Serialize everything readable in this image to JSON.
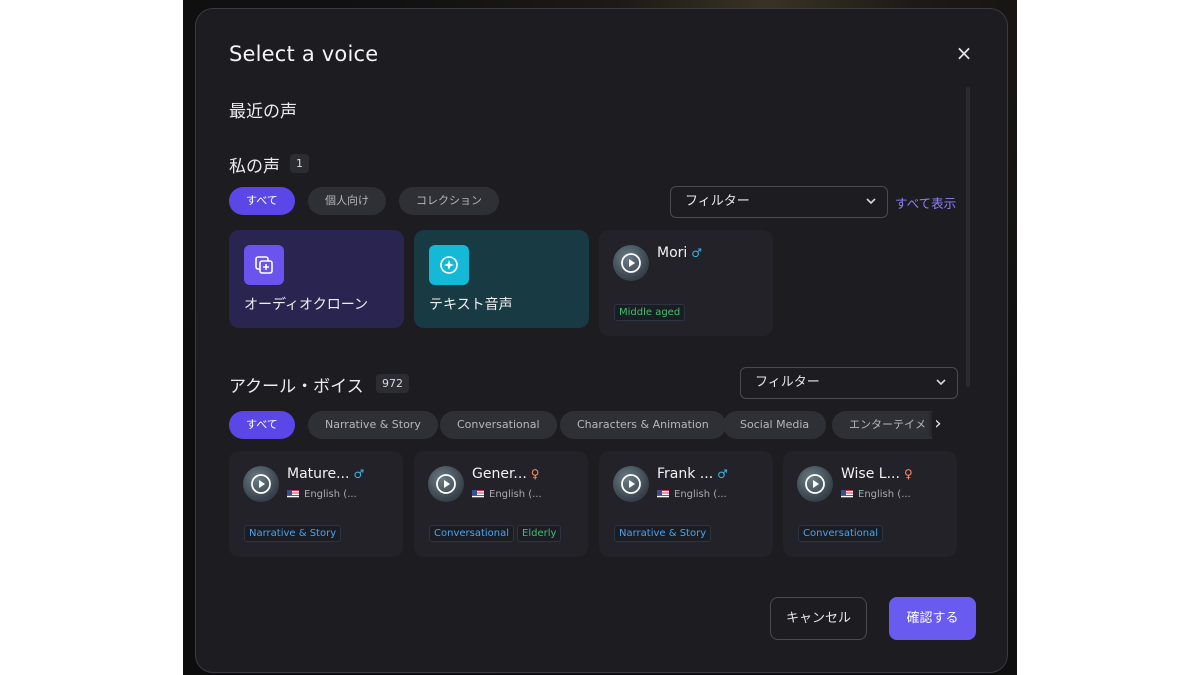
{
  "modal": {
    "title": "Select a voice",
    "close_symbol": "×"
  },
  "recent": {
    "heading": "最近の声"
  },
  "my_voices": {
    "heading": "私の声",
    "count": "1",
    "tabs": [
      "すべて",
      "個人向け",
      "コレクション"
    ],
    "filter_label": "フィルター",
    "show_all": "すべて表示",
    "create_cards": [
      {
        "label": "オーディオクローン",
        "icon": "audio-clone-icon",
        "bg": "#2a2550",
        "icon_bg": "#6b54ee"
      },
      {
        "label": "テキスト音声",
        "icon": "text-to-speech-icon",
        "bg": "#173a43",
        "icon_bg": "#16b8d8"
      }
    ],
    "voices": [
      {
        "name": "Mori",
        "gender": "♂",
        "gender_type": "male",
        "tags": [
          {
            "text": "Middle aged",
            "color": "green"
          }
        ]
      }
    ]
  },
  "acool_voices": {
    "heading": "アクール・ボイス",
    "count": "972",
    "filter_label": "フィルター",
    "categories": [
      "すべて",
      "Narrative & Story",
      "Conversational",
      "Characters & Animation",
      "Social Media",
      "エンターテイメ"
    ],
    "next_symbol": "›",
    "voices": [
      {
        "name": "Mature...",
        "gender": "♂",
        "gender_type": "male",
        "language": "English (...",
        "tags": [
          {
            "text": "Narrative & Story",
            "color": "blue"
          }
        ]
      },
      {
        "name": "Gener...",
        "gender": "♀",
        "gender_type": "female",
        "language": "English (...",
        "tags": [
          {
            "text": "Conversational",
            "color": "blue"
          },
          {
            "text": "Elderly",
            "color": "green"
          }
        ]
      },
      {
        "name": "Frank ...",
        "gender": "♂",
        "gender_type": "male",
        "language": "English (...",
        "tags": [
          {
            "text": "Narrative & Story",
            "color": "blue"
          }
        ]
      },
      {
        "name": "Wise L...",
        "gender": "♀",
        "gender_type": "female",
        "language": "English (...",
        "tags": [
          {
            "text": "Conversational",
            "color": "blue"
          }
        ]
      }
    ]
  },
  "footer": {
    "cancel_label": "キャンセル",
    "confirm_label": "確認する"
  },
  "colors": {
    "accent": "#5b46e8",
    "confirm": "#6a5bf0",
    "link": "#8f80ff",
    "tag_blue": "#4aa3f0",
    "tag_green": "#3fbf6c",
    "male": "#3ab6e8",
    "female": "#ff8a5c"
  }
}
